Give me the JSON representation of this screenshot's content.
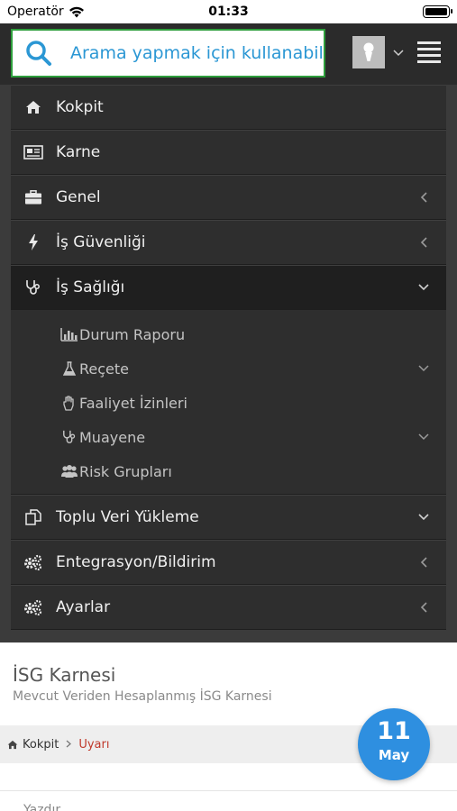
{
  "status_bar": {
    "carrier": "Operatör",
    "time": "01:33"
  },
  "search": {
    "placeholder": "Arama yapmak için kullanabilirsiniz"
  },
  "menu": {
    "kokpit": "Kokpit",
    "karne": "Karne",
    "genel": "Genel",
    "is_guvenligi": "İş Güvenliği",
    "is_sagligi": "İş Sağlığı",
    "is_sagligi_sub": {
      "durum_raporu": "Durum Raporu",
      "recete": "Reçete",
      "faaliyet_izinleri": "Faaliyet İzinleri",
      "muayene": "Muayene",
      "risk_gruplari": "Risk Grupları"
    },
    "toplu_veri": "Toplu Veri Yükleme",
    "entegrasyon": "Entegrasyon/Bildirim",
    "ayarlar": "Ayarlar"
  },
  "page": {
    "title": "İSG Karnesi",
    "subtitle": "Mevcut Veriden Hesaplanmış İSG Karnesi"
  },
  "breadcrumb": {
    "home": "Kokpit",
    "current": "Uyarı"
  },
  "date_badge": {
    "day": "11",
    "month": "May"
  },
  "print_label": "Yazdır",
  "colors": {
    "accent_blue": "#2e8fe0",
    "search_border": "#2e9e3c",
    "breadcrumb_current": "#c0392b"
  }
}
